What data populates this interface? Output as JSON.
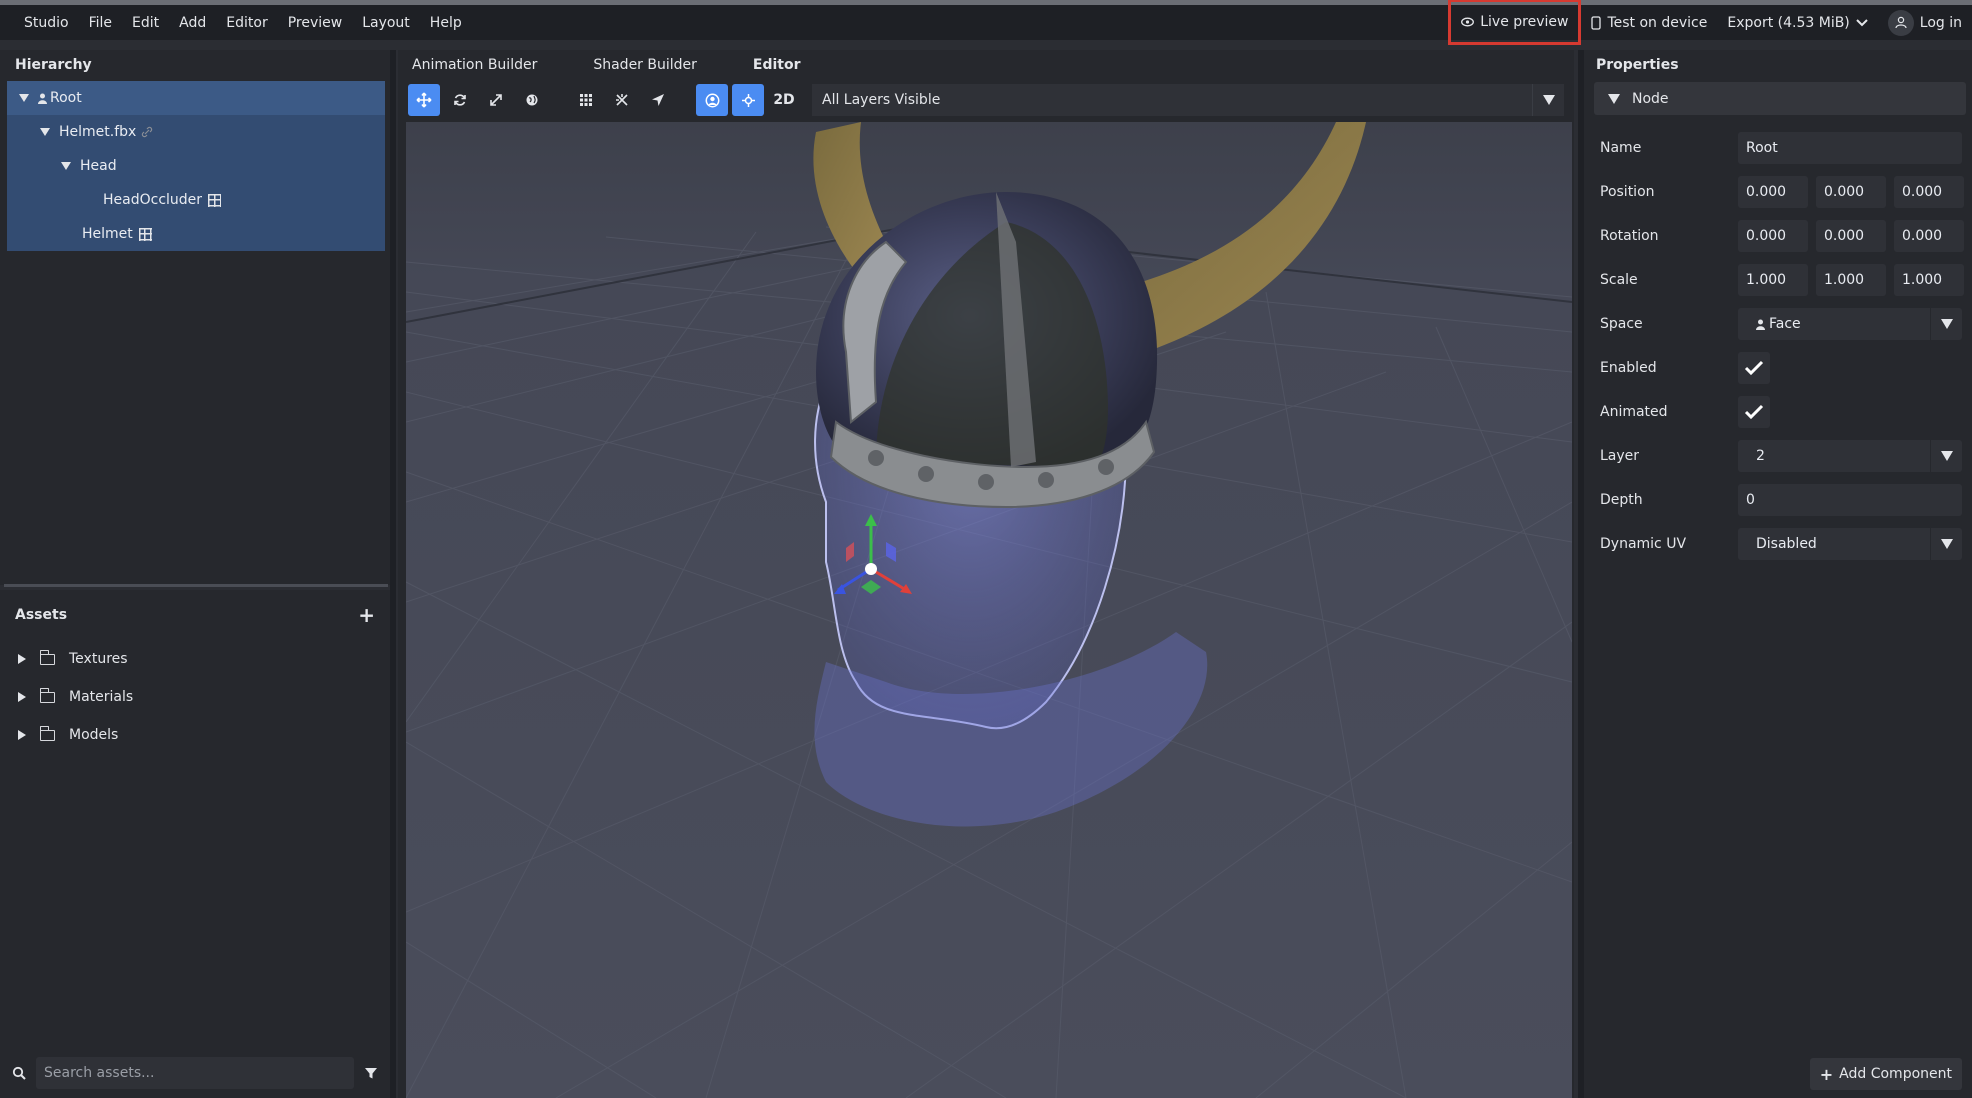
{
  "menubar": {
    "items": [
      "Studio",
      "File",
      "Edit",
      "Add",
      "Editor",
      "Preview",
      "Layout",
      "Help"
    ],
    "live_preview": "Live preview",
    "test_on_device": "Test on device",
    "export": "Export (4.53 MiB)",
    "login": "Log in"
  },
  "hierarchy": {
    "title": "Hierarchy",
    "items": [
      {
        "label": "Root"
      },
      {
        "label": "Helmet.fbx"
      },
      {
        "label": "Head"
      },
      {
        "label": "HeadOccluder"
      },
      {
        "label": "Helmet"
      }
    ]
  },
  "assets": {
    "title": "Assets",
    "folders": [
      {
        "label": "Textures"
      },
      {
        "label": "Materials"
      },
      {
        "label": "Models"
      }
    ],
    "search_placeholder": "Search assets..."
  },
  "editor": {
    "tabs": [
      {
        "label": "Animation Builder"
      },
      {
        "label": "Shader Builder"
      },
      {
        "label": "Editor"
      }
    ],
    "mode_2d": "2D",
    "layer_select": "All Layers Visible"
  },
  "properties": {
    "title": "Properties",
    "section": "Node",
    "name_label": "Name",
    "name_value": "Root",
    "position_label": "Position",
    "position": [
      "0.000",
      "0.000",
      "0.000"
    ],
    "rotation_label": "Rotation",
    "rotation": [
      "0.000",
      "0.000",
      "0.000"
    ],
    "scale_label": "Scale",
    "scale": [
      "1.000",
      "1.000",
      "1.000"
    ],
    "space_label": "Space",
    "space_value": "Face",
    "enabled_label": "Enabled",
    "animated_label": "Animated",
    "layer_label": "Layer",
    "layer_value": "2",
    "depth_label": "Depth",
    "depth_value": "0",
    "dynamic_uv_label": "Dynamic UV",
    "dynamic_uv_value": "Disabled",
    "add_component": "Add Component"
  },
  "colors": {
    "accent": "#4b8cf2",
    "highlight_border": "#d63a31",
    "selection": "#334c72"
  }
}
